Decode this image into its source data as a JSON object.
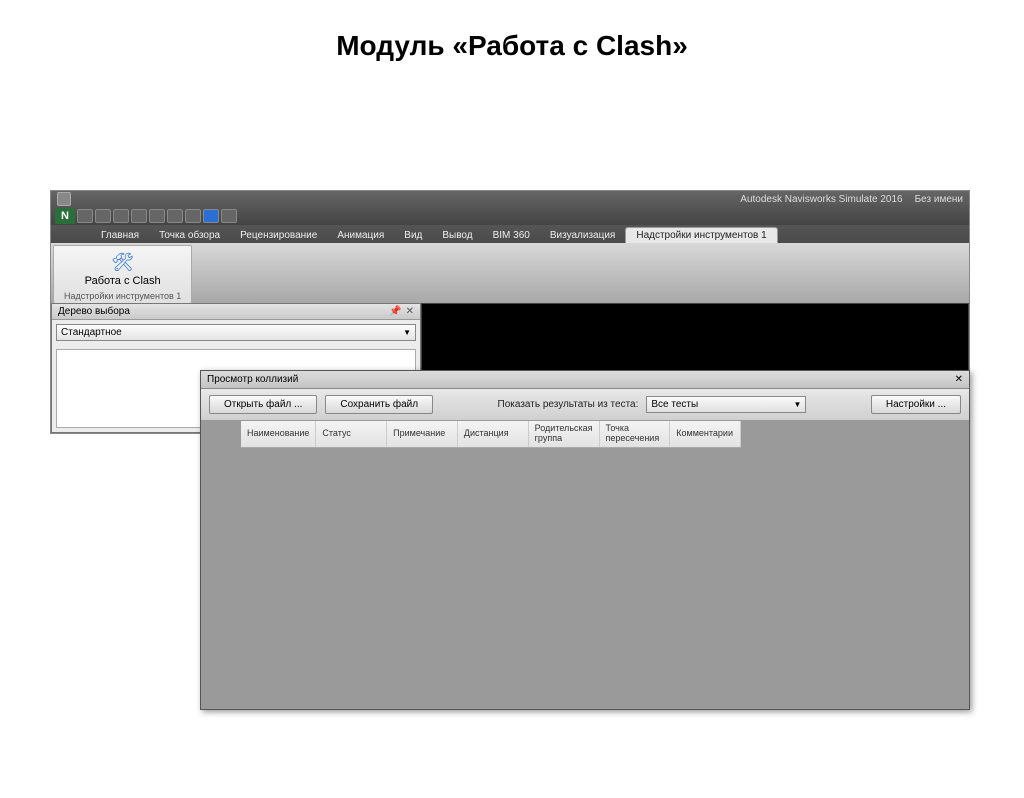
{
  "slide": {
    "title": "Модуль «Работа с Clash»"
  },
  "titlebar": {
    "app": "Autodesk Navisworks Simulate 2016",
    "doc": "Без имени"
  },
  "qat": {
    "logo": "N"
  },
  "ribbon": {
    "tabs": [
      "Главная",
      "Точка обзора",
      "Рецензирование",
      "Анимация",
      "Вид",
      "Вывод",
      "BIM 360",
      "Визуализация",
      "Надстройки инструментов 1"
    ],
    "active_index": 8,
    "group_label": "Надстройки инструментов 1",
    "clash_btn": "Работа с Clash"
  },
  "tree_panel": {
    "title": "Дерево выбора",
    "dropdown": "Стандартное"
  },
  "dialog": {
    "title": "Просмотр коллизий",
    "open_btn": "Открыть файл ...",
    "save_btn": "Сохранить файл",
    "filter_label": "Показать результаты из теста:",
    "filter_value": "Все тесты",
    "settings_btn": "Настройки ...",
    "columns": [
      "Наименование",
      "Статус",
      "Примечание",
      "Дистанция",
      "Родительская группа",
      "Точка пересечения",
      "Комментарии"
    ]
  }
}
